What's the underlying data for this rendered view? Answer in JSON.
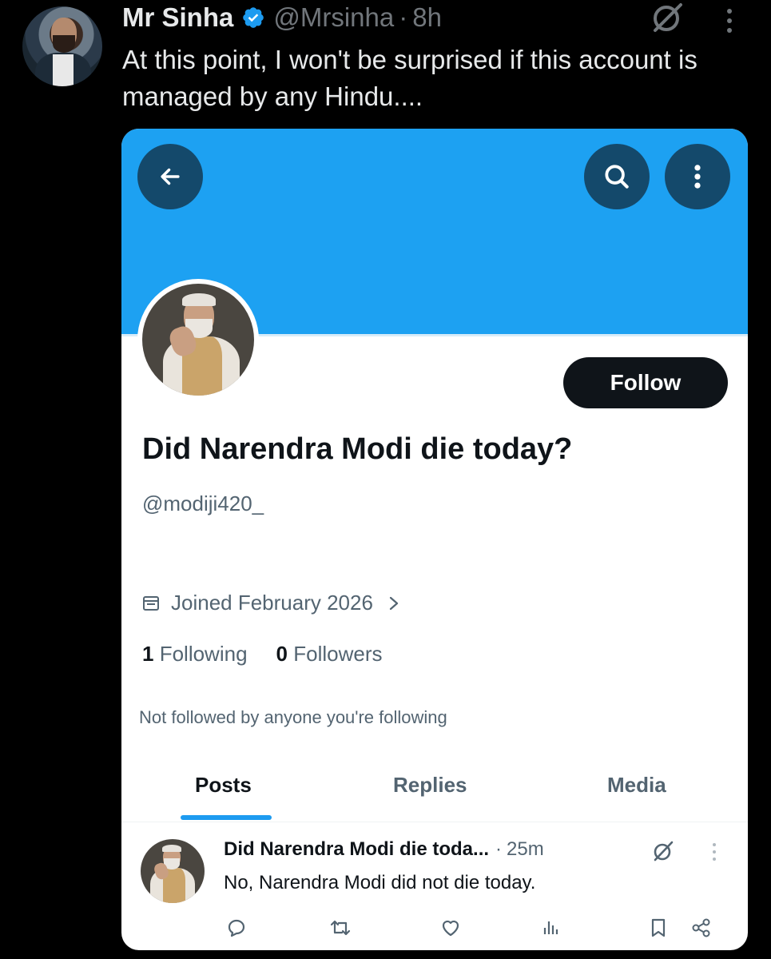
{
  "tweet": {
    "author_name": "Mr Sinha",
    "handle": "@Mrsinha",
    "separator": "·",
    "time": "8h",
    "text": "At this point, I won't be surprised if this account is managed by any Hindu....",
    "colors": {
      "background": "#000000",
      "text": "#e7e9ea",
      "muted": "#71767b",
      "verified": "#1d9bf0"
    }
  },
  "screenshot": {
    "banner_color": "#1da1f2",
    "follow_label": "Follow",
    "display_name": "Did Narendra Modi die today?",
    "handle": "@modiji420_",
    "joined": "Joined February 2026",
    "following_count": "1",
    "following_label": "Following",
    "followers_count": "0",
    "followers_label": "Followers",
    "not_followed": "Not followed by anyone you're following",
    "tabs": [
      {
        "label": "Posts",
        "active": true
      },
      {
        "label": "Replies",
        "active": false
      },
      {
        "label": "Media",
        "active": false
      }
    ],
    "post": {
      "author": "Did Narendra Modi die toda...",
      "separator": "·",
      "time": "25m",
      "text": "No, Narendra Modi did not die today."
    },
    "icons": [
      "back-arrow-icon",
      "search-icon",
      "more-vertical-icon",
      "calendar-icon",
      "chevron-right-icon",
      "reply-icon",
      "retweet-icon",
      "like-icon",
      "views-icon",
      "bookmark-icon",
      "share-icon"
    ]
  }
}
